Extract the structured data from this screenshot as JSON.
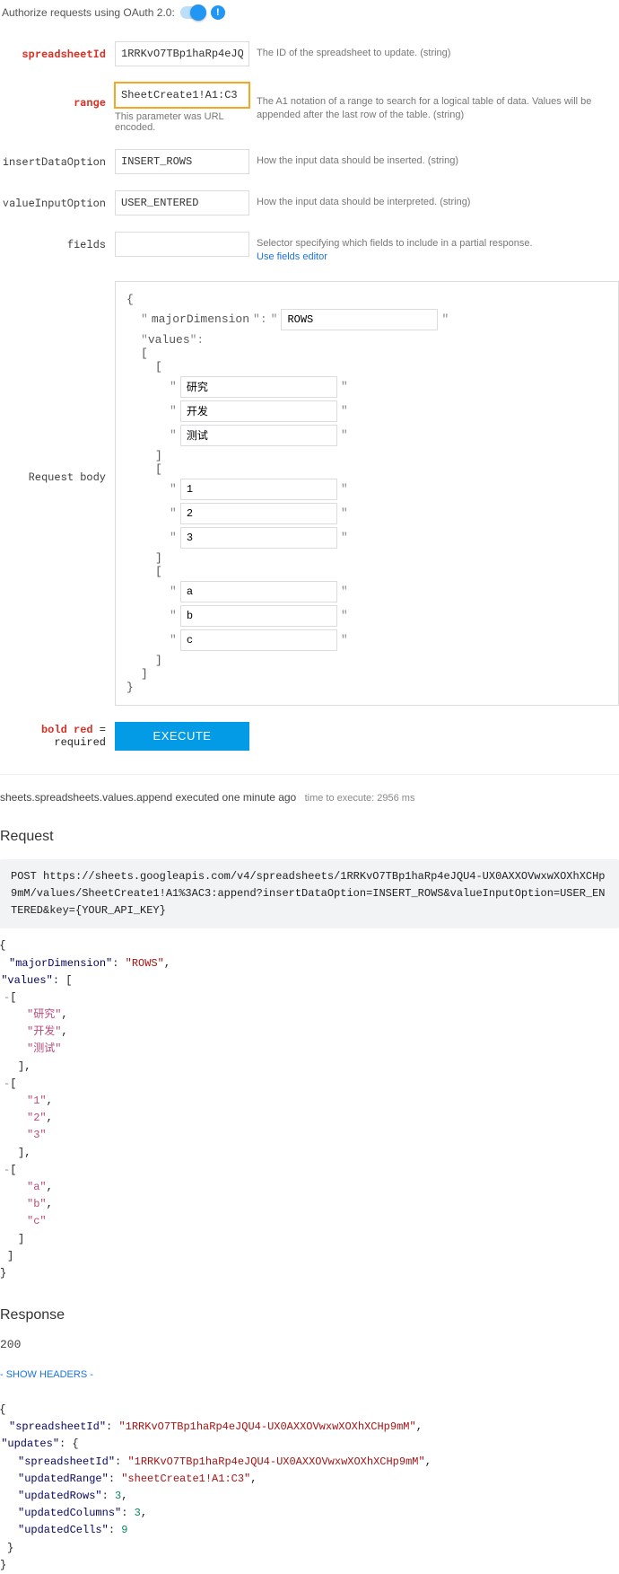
{
  "oauth_label": "Authorize requests using OAuth 2.0:",
  "fields": {
    "spreadsheetId": {
      "label": "spreadsheetId",
      "value": "1RRKvO7TBp1haRp4eJQU4-",
      "hint": "The ID of the spreadsheet to update. (string)"
    },
    "range": {
      "label": "range",
      "value": "SheetCreate1!A1:C3",
      "note": "This parameter was URL encoded.",
      "hint": "The A1 notation of a range to search for a logical table of data. Values will be appended after the last row of the table. (string)"
    },
    "insertDataOption": {
      "label": "insertDataOption",
      "value": "INSERT_ROWS",
      "hint": "How the input data should be inserted. (string)"
    },
    "valueInputOption": {
      "label": "valueInputOption",
      "value": "USER_ENTERED",
      "hint": "How the input data should be interpreted. (string)"
    },
    "fieldsParam": {
      "label": "fields",
      "value": "",
      "hint": "Selector specifying which fields to include in a partial response.",
      "link": "Use fields editor"
    },
    "body_label": "Request body"
  },
  "body": {
    "majorDimension_key": "majorDimension",
    "majorDimension_val": "ROWS",
    "values_key": "values",
    "rows": [
      [
        "研究",
        "开发",
        "测试"
      ],
      [
        "1",
        "2",
        "3"
      ],
      [
        "a",
        "b",
        "c"
      ]
    ]
  },
  "footer": {
    "note_bold": "bold red",
    "note_rest": " = required",
    "button": "EXECUTE"
  },
  "exec_status": {
    "title": "sheets.spreadsheets.values.append executed one minute ago",
    "timing": "time to execute: 2956 ms"
  },
  "request_title": "Request",
  "request_block": "POST https://sheets.googleapis.com/v4/spreadsheets/1RRKvO7TBp1haRp4eJQU4-UX0AXXOVwxwXOXhXCHp9mM/values/SheetCreate1!A1%3AC3:append?insertDataOption=INSERT_ROWS&valueInputOption=USER_ENTERED&key={YOUR_API_KEY}",
  "request_json": {
    "majorDimension": "ROWS",
    "values": [
      [
        "研究",
        "开发",
        "测试"
      ],
      [
        "1",
        "2",
        "3"
      ],
      [
        "a",
        "b",
        "c"
      ]
    ]
  },
  "response_title": "Response",
  "response_status": "200",
  "show_headers": "- SHOW HEADERS -",
  "response_json": {
    "spreadsheetId": "1RRKvO7TBp1haRp4eJQU4-UX0AXXOVwxwXOXhXCHp9mM",
    "updates": {
      "spreadsheetId": "1RRKvO7TBp1haRp4eJQU4-UX0AXXOVwxwXOXhXCHp9mM",
      "updatedRange": "sheetCreate1!A1:C3",
      "updatedRows": 3,
      "updatedColumns": 3,
      "updatedCells": 9
    }
  }
}
